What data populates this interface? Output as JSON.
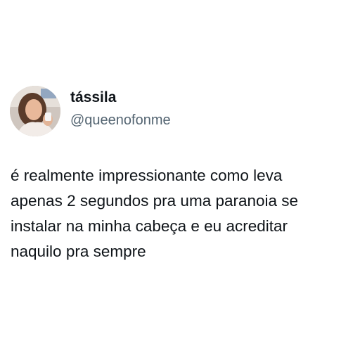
{
  "tweet": {
    "author": {
      "display_name": "tássila",
      "handle": "@queenofonme"
    },
    "text_lines": [
      "é realmente impressionante como leva",
      "apenas 2 segundos pra uma paranoia se",
      "instalar na minha cabeça e eu acreditar",
      "naquilo pra sempre"
    ]
  },
  "colors": {
    "background": "#ffffff",
    "name": "#0f1419",
    "handle": "#536471",
    "body_text": "#0f1419"
  }
}
